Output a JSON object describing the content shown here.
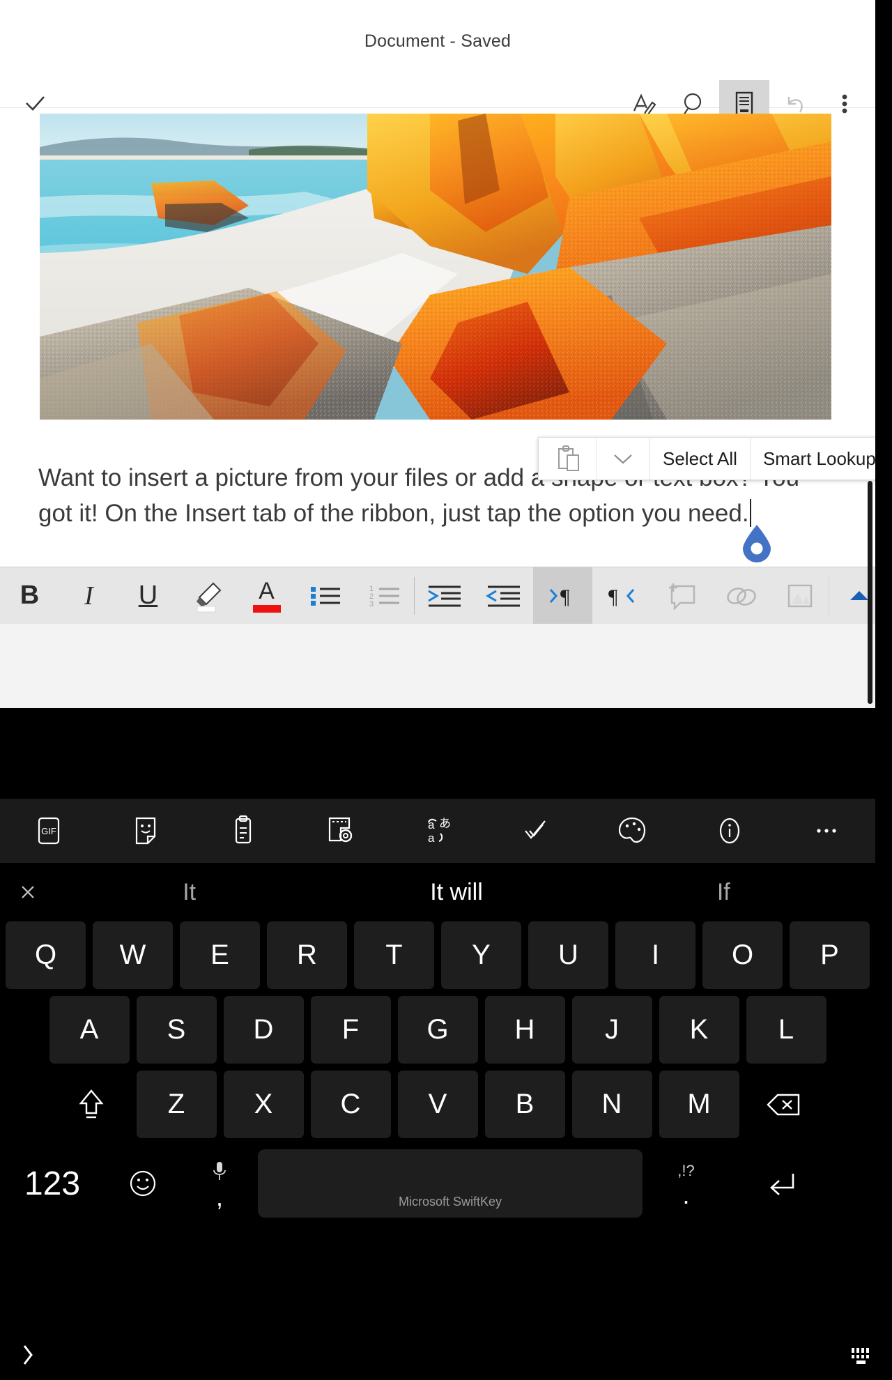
{
  "window": {
    "doc_title": "Document - Saved"
  },
  "titlebar": {
    "done_icon": "check-icon",
    "actions": [
      {
        "name": "ink-icon",
        "label": "Ink"
      },
      {
        "name": "search-icon",
        "label": "Search"
      },
      {
        "name": "mobile-view-icon",
        "label": "Mobile View"
      },
      {
        "name": "undo-icon",
        "label": "Undo"
      },
      {
        "name": "more-icon",
        "label": "More"
      }
    ]
  },
  "document": {
    "picture_alt": "Bay of Fires orange lichen granite boulders on white sand beach",
    "paragraph": "Want to insert a picture from your files or add a shape or text box? You got it! On the Insert tab of the ribbon, just tap the option you need.",
    "cursor_handle": "text-cursor-handle",
    "handle_color": "#4472C4"
  },
  "context_menu": {
    "paste_icon": "paste-icon",
    "expand_icon": "chevron-down-icon",
    "items": [
      {
        "label": "Select All"
      },
      {
        "label": "Smart Lookup"
      }
    ]
  },
  "ribbon": {
    "background": "#e6e6e6",
    "active_background": "#cdcdcd",
    "font_color_swatch": "#ee1111",
    "items": [
      {
        "name": "bold-button",
        "label": "B",
        "state": "normal"
      },
      {
        "name": "italic-button",
        "label": "I",
        "state": "normal"
      },
      {
        "name": "underline-button",
        "label": "U",
        "state": "normal"
      },
      {
        "name": "highlight-button",
        "label": "",
        "state": "normal"
      },
      {
        "name": "font-color-button",
        "label": "A",
        "state": "normal"
      },
      {
        "name": "bullet-list-button",
        "label": "",
        "state": "normal"
      },
      {
        "name": "numbered-list-button",
        "label": "",
        "state": "normal"
      },
      {
        "name": "increase-indent-button",
        "label": "",
        "state": "normal"
      },
      {
        "name": "decrease-indent-button",
        "label": "",
        "state": "normal"
      },
      {
        "name": "ltr-paragraph-button",
        "label": "",
        "state": "active"
      },
      {
        "name": "rtl-paragraph-button",
        "label": "",
        "state": "normal"
      },
      {
        "name": "comment-button",
        "label": "",
        "state": "disabled"
      },
      {
        "name": "link-button",
        "label": "",
        "state": "disabled"
      },
      {
        "name": "picture-button",
        "label": "",
        "state": "disabled"
      },
      {
        "name": "collapse-ribbon-button",
        "label": "",
        "state": "normal"
      }
    ]
  },
  "keyboard": {
    "app_name": "Microsoft SwiftKey",
    "toolbar": [
      {
        "name": "gif-icon",
        "label": "GIF"
      },
      {
        "name": "sticker-icon",
        "label": "Stickers"
      },
      {
        "name": "clipboard-icon",
        "label": "Clipboard"
      },
      {
        "name": "customize-icon",
        "label": "Customize"
      },
      {
        "name": "translator-icon",
        "label": "Translator"
      },
      {
        "name": "editor-icon",
        "label": "Editor"
      },
      {
        "name": "theme-icon",
        "label": "Themes"
      },
      {
        "name": "info-icon",
        "label": "Info"
      },
      {
        "name": "more-icon",
        "label": "More"
      }
    ],
    "predictions": {
      "close_icon": "close-icon",
      "left": "It",
      "center": "It will",
      "right": "If"
    },
    "row1": [
      "Q",
      "W",
      "E",
      "R",
      "T",
      "Y",
      "U",
      "I",
      "O",
      "P"
    ],
    "row2": [
      "A",
      "S",
      "D",
      "F",
      "G",
      "H",
      "J",
      "K",
      "L"
    ],
    "row3": [
      "Z",
      "X",
      "C",
      "V",
      "B",
      "N",
      "M"
    ],
    "shift_icon": "shift-icon",
    "backspace_icon": "backspace-icon",
    "bottom": {
      "numbers_label": "123",
      "emoji_icon": "emoji-icon",
      "mic_icon": "microphone-icon",
      "comma_label": ",",
      "space_label": "Microsoft SwiftKey",
      "punct_label": ",!?",
      "period_label": ".",
      "enter_icon": "enter-icon"
    }
  },
  "navbar": {
    "back_icon": "back-chevron-icon",
    "hide_keyboard_icon": "hide-keyboard-icon"
  }
}
